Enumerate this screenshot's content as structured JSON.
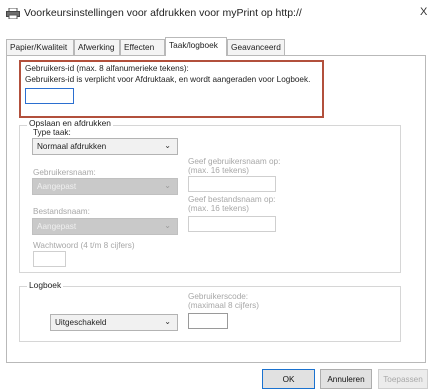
{
  "window": {
    "title": "Voorkeursinstellingen voor afdrukken voor myPrint op http://",
    "close_glyph": "X"
  },
  "tabs": [
    {
      "label": "Papier/Kwaliteit"
    },
    {
      "label": "Afwerking"
    },
    {
      "label": "Effecten"
    },
    {
      "label": "Taak/logboek"
    },
    {
      "label": "Geavanceerd"
    }
  ],
  "active_tab": "Taak/logboek",
  "userid": {
    "label": "Gebruikers-id (max. 8 alfanumerieke tekens):",
    "note": "Gebruikers-id is verplicht voor Afdruktaak, en wordt aangeraden voor Logboek.",
    "value": ""
  },
  "save_print": {
    "group_title": "Opslaan en afdrukken",
    "job_type_label": "Type taak:",
    "job_type_value": "Normaal afdrukken",
    "username_label": "Gebruikersnaam:",
    "username_value": "Aangepast",
    "give_username_line1": "Geef gebruikersnaam op:",
    "give_username_line2": "(max. 16 tekens)",
    "filename_label": "Bestandsnaam:",
    "filename_value": "Aangepast",
    "give_filename_line1": "Geef bestandsnaam op:",
    "give_filename_line2": "(max. 16 tekens)",
    "password_label": "Wachtwoord (4 t/m 8 cijfers)"
  },
  "logbook": {
    "group_title": "Logboek",
    "user_code_line1": "Gebruikerscode:",
    "user_code_line2": "(maximaal 8 cijfers)",
    "mode_value": "Uitgeschakeld"
  },
  "buttons": {
    "ok": "OK",
    "cancel": "Annuleren",
    "apply": "Toepassen"
  },
  "icons": {
    "printer": "printer-icon",
    "chevron": "chevron-down-icon"
  },
  "colors": {
    "highlight_border": "#b2503c",
    "focus_blue": "#2b6fd0"
  }
}
